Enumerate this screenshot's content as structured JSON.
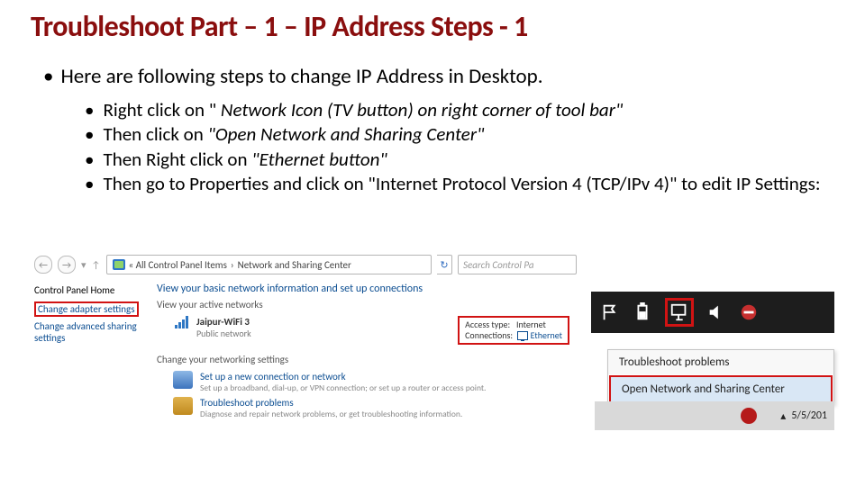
{
  "title": "Troubleshoot Part – 1 – IP Address Steps - 1",
  "intro": "Here are following steps to change IP Address in Desktop.",
  "steps": [
    [
      {
        "t": "Right click on \" ",
        "i": false
      },
      {
        "t": "Network Icon (TV button) on right corner of tool bar\"",
        "i": true
      }
    ],
    [
      {
        "t": "Then click on ",
        "i": false
      },
      {
        "t": "\"Open Network and Sharing Center\"",
        "i": true
      }
    ],
    [
      {
        "t": "Then Right click on ",
        "i": false
      },
      {
        "t": "\"Ethernet button\"",
        "i": true
      }
    ],
    [
      {
        "t": "Then go to Properties and click on \"Internet Protocol Version 4 (TCP/IPv 4)\" to edit IP Settings:",
        "i": false
      }
    ]
  ],
  "ns": {
    "breadcrumb_pre": "«  All Control Panel Items",
    "breadcrumb_cur": "Network and Sharing Center",
    "search_placeholder": "Search Control Pa",
    "side_home": "Control Panel Home",
    "side_link_adapter": "Change adapter settings",
    "side_link_adv": "Change advanced sharing settings",
    "headline": "View your basic network information and set up connections",
    "sub": "View your active networks",
    "net_name": "Jaipur-WiFi 3",
    "net_type": "Public network",
    "kv_access_label": "Access type:",
    "kv_access_val": "Internet",
    "kv_conn_label": "Connections:",
    "kv_conn_val": "Ethernet",
    "change_head": "Change your networking settings",
    "opt1_t": "Set up a new connection or network",
    "opt1_d": "Set up a broadband, dial-up, or VPN connection; or set up a router or access point.",
    "opt2_t": "Troubleshoot problems",
    "opt2_d": "Diagnose and repair network problems, or get troubleshooting information."
  },
  "ctx": {
    "item1": "Troubleshoot problems",
    "item2": "Open Network and Sharing Center"
  },
  "taskbar_date": "5/5/201"
}
